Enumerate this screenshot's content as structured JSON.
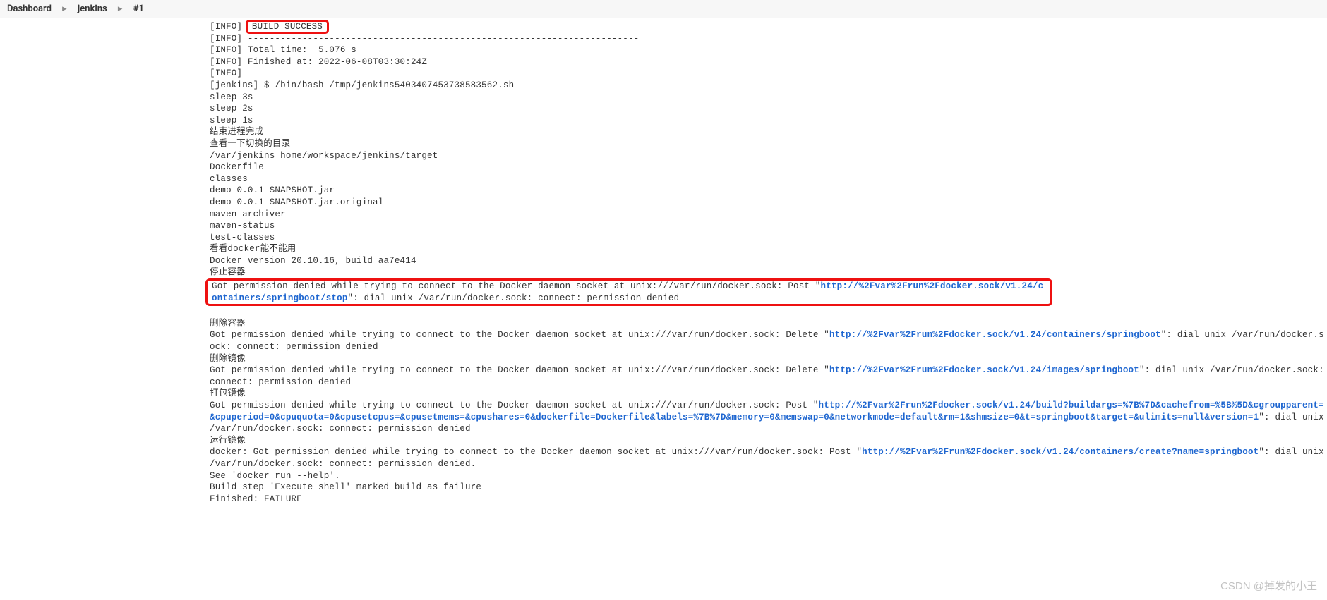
{
  "breadcrumb": {
    "items": [
      "Dashboard",
      "jenkins",
      "#1"
    ],
    "separator": "▸"
  },
  "highlight_inline": "BUILD SUCCESS",
  "log_pre1": "[INFO] ",
  "log_block1": "[INFO] ------------------------------------------------------------------------\n[INFO] Total time:  5.076 s\n[INFO] Finished at: 2022-06-08T03:30:24Z\n[INFO] ------------------------------------------------------------------------\n[jenkins] $ /bin/bash /tmp/jenkins5403407453738583562.sh\nsleep 3s\nsleep 2s\nsleep 1s\n结束进程完成\n查看一下切换的目录\n/var/jenkins_home/workspace/jenkins/target\nDockerfile\nclasses\ndemo-0.0.1-SNAPSHOT.jar\ndemo-0.0.1-SNAPSHOT.jar.original\nmaven-archiver\nmaven-status\ntest-classes\n看看docker能不能用\nDocker version 20.10.16, build aa7e414\n停止容器",
  "err1": {
    "pre": "Got permission denied while trying to connect to the Docker daemon socket at unix:///var/run/docker.sock: Post \"",
    "link": "http://%2Fvar%2Frun%2Fdocker.sock/v1.24/containers/springboot/stop",
    "post": "\": dial unix /var/run/docker.sock: connect: permission denied"
  },
  "heading_delete_container": "删除容器",
  "err2": {
    "pre": "Got permission denied while trying to connect to the Docker daemon socket at unix:///var/run/docker.sock: Delete \"",
    "link": "http://%2Fvar%2Frun%2Fdocker.sock/v1.24/containers/springboot",
    "post": "\": dial unix /var/run/docker.sock: connect: permission denied"
  },
  "heading_delete_image": "删除镜像",
  "err3": {
    "pre": "Got permission denied while trying to connect to the Docker daemon socket at unix:///var/run/docker.sock: Delete \"",
    "link": "http://%2Fvar%2Frun%2Fdocker.sock/v1.24/images/springboot",
    "post": "\": dial unix /var/run/docker.sock: connect: permission denied"
  },
  "heading_build_image": "打包镜像",
  "err4": {
    "pre": "Got permission denied while trying to connect to the Docker daemon socket at unix:///var/run/docker.sock: Post \"",
    "link": "http://%2Fvar%2Frun%2Fdocker.sock/v1.24/build?buildargs=%7B%7D&cachefrom=%5B%5D&cgroupparent=&cpuperiod=0&cpuquota=0&cpusetcpus=&cpusetmems=&cpushares=0&dockerfile=Dockerfile&labels=%7B%7D&memory=0&memswap=0&networkmode=default&rm=1&shmsize=0&t=springboot&target=&ulimits=null&version=1",
    "post": "\": dial unix /var/run/docker.sock: connect: permission denied"
  },
  "heading_run_image": "运行镜像",
  "err5": {
    "pre": "docker: Got permission denied while trying to connect to the Docker daemon socket at unix:///var/run/docker.sock: Post \"",
    "link": "http://%2Fvar%2Frun%2Fdocker.sock/v1.24/containers/create?name=springboot",
    "post": "\": dial unix /var/run/docker.sock: connect: permission denied."
  },
  "tail": "See 'docker run --help'.\nBuild step 'Execute shell' marked build as failure\nFinished: FAILURE",
  "watermark": "CSDN @掉发的小王"
}
